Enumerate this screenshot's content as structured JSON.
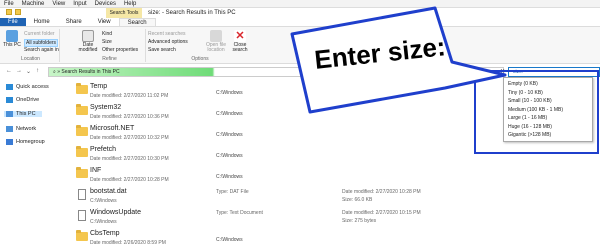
{
  "vm_menu": [
    "File",
    "Machine",
    "View",
    "Input",
    "Devices",
    "Help"
  ],
  "title": {
    "contextual_tab": "Search Tools",
    "window_title": "size: - Search Results in This PC"
  },
  "ribbon_tabs": [
    {
      "label": "File",
      "kind": "file"
    },
    {
      "label": "Home",
      "kind": "normal"
    },
    {
      "label": "Share",
      "kind": "normal"
    },
    {
      "label": "View",
      "kind": "normal"
    },
    {
      "label": "Search",
      "kind": "active"
    }
  ],
  "ribbon": {
    "location": {
      "this_pc": "This PC",
      "current_folder": "Current folder",
      "all_subfolders": "All subfolders",
      "search_again": "Search again in",
      "label": "Location"
    },
    "refine": {
      "date_modified": "Date modified",
      "kind": "Kind",
      "size": "Size",
      "other_properties": "Other properties",
      "label": "Refine"
    },
    "options": {
      "recent_searches": "Recent searches",
      "advanced_options": "Advanced options",
      "save_search": "Save search",
      "open_file_location": "Open file location",
      "close_search": "Close search",
      "label": "Options"
    }
  },
  "address": {
    "path": "Search Results in This PC",
    "search_value": "size:"
  },
  "nav": [
    {
      "label": "Quick access",
      "icon": "star-icon",
      "color": "#2a8ad6"
    },
    {
      "label": "OneDrive",
      "icon": "cloud-icon",
      "color": "#2a8ad6"
    },
    {
      "label": "This PC",
      "icon": "computer-icon",
      "color": "#4a90d9",
      "selected": true
    },
    {
      "label": "Network",
      "icon": "network-icon",
      "color": "#4a90d9"
    },
    {
      "label": "Homegroup",
      "icon": "homegroup-icon",
      "color": "#3a7bd5"
    }
  ],
  "files": [
    {
      "name": "Temp",
      "kind": "folder",
      "meta": "Date modified: 2/27/2020 11:02 PM",
      "path": "C:\\Windows"
    },
    {
      "name": "System32",
      "kind": "folder",
      "meta": "Date modified: 2/27/2020 10:36 PM",
      "path": "C:\\Windows"
    },
    {
      "name": "Microsoft.NET",
      "kind": "folder",
      "meta": "Date modified: 2/27/2020 10:32 PM",
      "path": "C:\\Windows"
    },
    {
      "name": "Prefetch",
      "kind": "folder",
      "meta": "Date modified: 2/27/2020 10:30 PM",
      "path": "C:\\Windows"
    },
    {
      "name": "INF",
      "kind": "folder",
      "meta": "Date modified: 2/27/2020 10:28 PM",
      "path": "C:\\Windows"
    },
    {
      "name": "bootstat.dat",
      "kind": "file",
      "meta": "C:\\Windows",
      "type": "Type: DAT File",
      "mod": "Date modified: 2/27/2020 10:28 PM",
      "size": "Size: 66.0 KB"
    },
    {
      "name": "WindowsUpdate",
      "kind": "file",
      "meta": "C:\\Windows",
      "type": "Type: Text Document",
      "mod": "Date modified: 2/27/2020 10:15 PM",
      "size": "Size: 275 bytes"
    },
    {
      "name": "CbsTemp",
      "kind": "folder",
      "meta": "Date modified: 2/26/2020 8:59 PM",
      "path": "C:\\Windows"
    }
  ],
  "size_options": [
    "Empty (0 KB)",
    "Tiny (0 - 10 KB)",
    "Small (10 - 100 KB)",
    "Medium (100 KB - 1 MB)",
    "Large (1 - 16 MB)",
    "Huge (16 - 128 MB)",
    "Gigantic (>128 MB)"
  ],
  "callout": {
    "text": "Enter size:",
    "border_color": "#1f3fcc"
  }
}
